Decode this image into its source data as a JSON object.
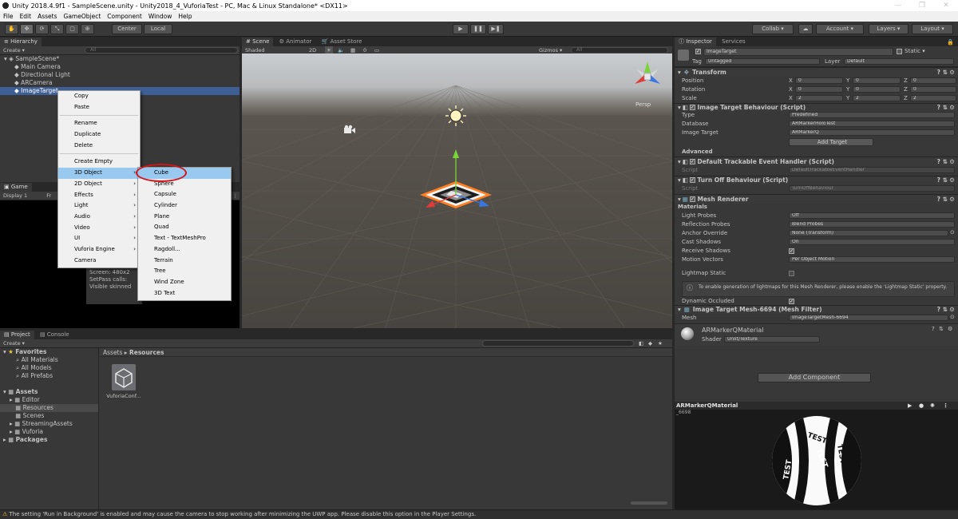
{
  "title": "Unity 2018.4.9f1 - SampleScene.unity - Unity2018_4_VuforiaTest - PC, Mac & Linux Standalone* <DX11>",
  "menu": [
    "File",
    "Edit",
    "Assets",
    "GameObject",
    "Component",
    "Window",
    "Help"
  ],
  "toolbar": {
    "center": "Center",
    "local": "Local",
    "collab": "Collab ▾",
    "account": "Account",
    "layers": "Layers",
    "layout": "Layout"
  },
  "hierarchy": {
    "tab": "Hierarchy",
    "create": "Create ▾",
    "search": "All",
    "scene": "SampleScene*",
    "items": [
      "Main Camera",
      "Directional Light",
      "ARCamera",
      "ImageTarget"
    ]
  },
  "context_menu": {
    "items": [
      "Copy",
      "Paste",
      "Rename",
      "Duplicate",
      "Delete",
      "Create Empty",
      "3D Object",
      "2D Object",
      "Effects",
      "Light",
      "Audio",
      "Video",
      "UI",
      "Vuforia Engine",
      "Camera"
    ]
  },
  "submenu": {
    "items": [
      "Cube",
      "Sphere",
      "Capsule",
      "Cylinder",
      "Plane",
      "Quad",
      "Text - TextMeshPro",
      "Ragdoll...",
      "Terrain",
      "Tree",
      "Wind Zone",
      "3D Text"
    ]
  },
  "game": {
    "tab": "Game",
    "display": "Display 1",
    "free": "Fr",
    "stats": [
      "Screen: 480x2",
      "SetPass calls:",
      "Visible skinned"
    ]
  },
  "scene": {
    "tabs": [
      "Scene",
      "Animator",
      "Asset Store"
    ],
    "shaded": "Shaded",
    "mode2d": "2D",
    "gizmos": "Gizmos ▾",
    "search": "All",
    "persp": "Persp"
  },
  "project": {
    "tabs": [
      "Project",
      "Console"
    ],
    "create": "Create ▾",
    "breadcrumb": [
      "Assets",
      "Resources"
    ],
    "favorites": "Favorites",
    "fav_items": [
      "All Materials",
      "All Models",
      "All Prefabs"
    ],
    "assets": "Assets",
    "asset_items": [
      "Editor",
      "Resources",
      "Scenes",
      "StreamingAssets",
      "Vuforia"
    ],
    "packages": "Packages",
    "file": "VuforiaConf..."
  },
  "inspector": {
    "tabs": [
      "Inspector",
      "Services"
    ],
    "object_name": "ImageTarget",
    "static": "Static ▾",
    "tag_label": "Tag",
    "tag": "Untagged",
    "layer_label": "Layer",
    "layer": "Default",
    "transform": {
      "title": "Transform",
      "rows": [
        {
          "label": "Position",
          "x": "0",
          "y": "0",
          "z": "0"
        },
        {
          "label": "Rotation",
          "x": "0",
          "y": "0",
          "z": "0"
        },
        {
          "label": "Scale",
          "x": "2",
          "y": "2",
          "z": "2"
        }
      ]
    },
    "itb": {
      "title": "Image Target Behaviour (Script)",
      "type_label": "Type",
      "type": "Predefined",
      "db_label": "Database",
      "db": "ARMarkerHoloTest",
      "it_label": "Image Target",
      "it": "ARMarkerQ",
      "add": "Add Target",
      "advanced": "Advanced"
    },
    "dteh": {
      "title": "Default Trackable Event Handler (Script)",
      "script_label": "Script",
      "script": "DefaultTrackableEventHandler"
    },
    "tob": {
      "title": "Turn Off Behaviour (Script)",
      "script_label": "Script",
      "script": "TurnOffBehaviour"
    },
    "mr": {
      "title": "Mesh Renderer",
      "materials": "Materials",
      "rows": [
        {
          "label": "Light Probes",
          "value": "Off"
        },
        {
          "label": "Reflection Probes",
          "value": "Blend Probes"
        },
        {
          "label": "Anchor Override",
          "value": "None (Transform)"
        },
        {
          "label": "Cast Shadows",
          "value": "On"
        }
      ],
      "receive": "Receive Shadows",
      "motion_label": "Motion Vectors",
      "motion": "Per Object Motion",
      "lightmap": "Lightmap Static",
      "info": "To enable generation of lightmaps for this Mesh Renderer, please enable the 'Lightmap Static' property.",
      "dyn": "Dynamic Occluded"
    },
    "mf": {
      "title": "Image Target Mesh-6694 (Mesh Filter)",
      "mesh_label": "Mesh",
      "mesh": "ImageTargetMesh-6694"
    },
    "mat": {
      "title": "ARMarkerQMaterial",
      "shader_label": "Shader",
      "shader": "Unlit/Texture"
    },
    "add_component": "Add Component",
    "preview_title": "ARMarkerQMaterial",
    "preview_sub": "_6698"
  },
  "status": "The setting 'Run in Background' is enabled and may cause the camera to stop working after minimizing the UWP app. Please disable this option in the Player Settings."
}
